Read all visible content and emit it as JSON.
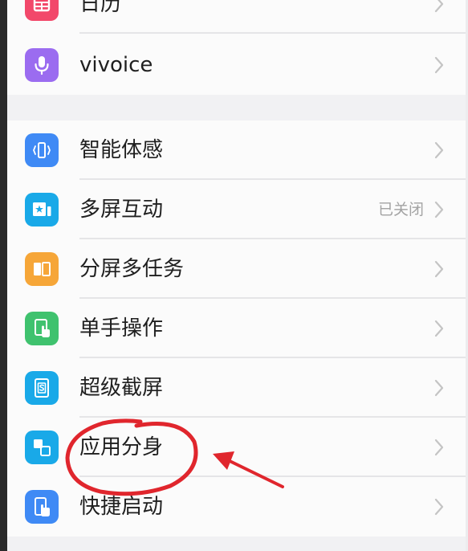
{
  "settings": {
    "group1": [
      {
        "label": "日历",
        "icon": "calendar-icon",
        "color": "#f2486a"
      },
      {
        "label": "vivoice",
        "icon": "microphone-icon",
        "color": "#9b6cf0"
      }
    ],
    "group2": [
      {
        "label": "智能体感",
        "icon": "motion-sense-icon",
        "color": "#3f8af5",
        "value": ""
      },
      {
        "label": "多屏互动",
        "icon": "multi-screen-icon",
        "color": "#19a9e8",
        "value": "已关闭"
      },
      {
        "label": "分屏多任务",
        "icon": "split-screen-icon",
        "color": "#f6a638",
        "value": ""
      },
      {
        "label": "单手操作",
        "icon": "one-hand-icon",
        "color": "#3fc26e",
        "value": ""
      },
      {
        "label": "超级截屏",
        "icon": "screenshot-icon",
        "color": "#19a9e8",
        "value": ""
      },
      {
        "label": "应用分身",
        "icon": "app-clone-icon",
        "color": "#19a9e8",
        "value": ""
      },
      {
        "label": "快捷启动",
        "icon": "quick-launch-icon",
        "color": "#3f8af5",
        "value": ""
      }
    ]
  },
  "colors": {
    "annotation": "#e0262d",
    "chevron": "#c4c4c4",
    "label": "#1f1f1f",
    "value": "#a3a3a3"
  }
}
